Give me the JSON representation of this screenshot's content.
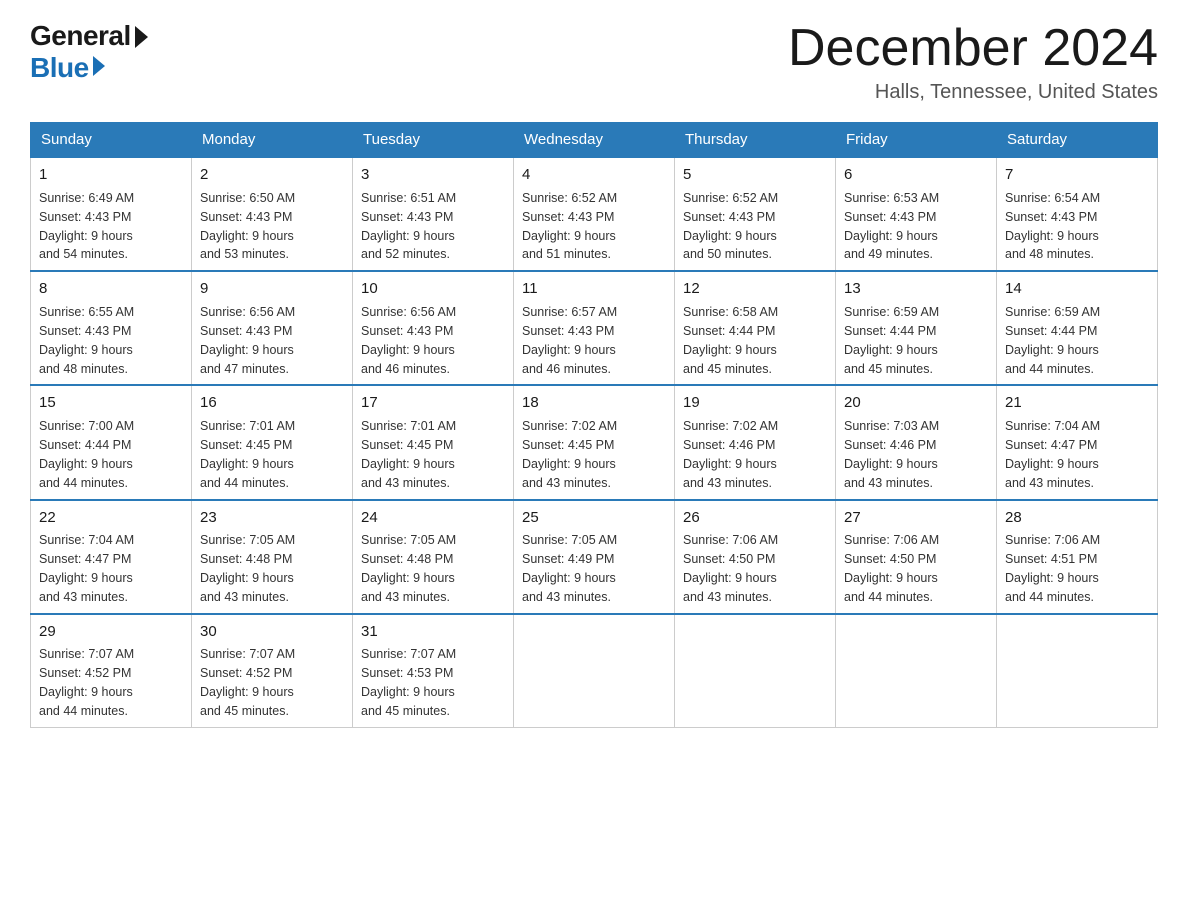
{
  "logo": {
    "general": "General",
    "blue": "Blue"
  },
  "title": "December 2024",
  "location": "Halls, Tennessee, United States",
  "days_of_week": [
    "Sunday",
    "Monday",
    "Tuesday",
    "Wednesday",
    "Thursday",
    "Friday",
    "Saturday"
  ],
  "weeks": [
    [
      {
        "day": "1",
        "sunrise": "6:49 AM",
        "sunset": "4:43 PM",
        "daylight": "9 hours and 54 minutes."
      },
      {
        "day": "2",
        "sunrise": "6:50 AM",
        "sunset": "4:43 PM",
        "daylight": "9 hours and 53 minutes."
      },
      {
        "day": "3",
        "sunrise": "6:51 AM",
        "sunset": "4:43 PM",
        "daylight": "9 hours and 52 minutes."
      },
      {
        "day": "4",
        "sunrise": "6:52 AM",
        "sunset": "4:43 PM",
        "daylight": "9 hours and 51 minutes."
      },
      {
        "day": "5",
        "sunrise": "6:52 AM",
        "sunset": "4:43 PM",
        "daylight": "9 hours and 50 minutes."
      },
      {
        "day": "6",
        "sunrise": "6:53 AM",
        "sunset": "4:43 PM",
        "daylight": "9 hours and 49 minutes."
      },
      {
        "day": "7",
        "sunrise": "6:54 AM",
        "sunset": "4:43 PM",
        "daylight": "9 hours and 48 minutes."
      }
    ],
    [
      {
        "day": "8",
        "sunrise": "6:55 AM",
        "sunset": "4:43 PM",
        "daylight": "9 hours and 48 minutes."
      },
      {
        "day": "9",
        "sunrise": "6:56 AM",
        "sunset": "4:43 PM",
        "daylight": "9 hours and 47 minutes."
      },
      {
        "day": "10",
        "sunrise": "6:56 AM",
        "sunset": "4:43 PM",
        "daylight": "9 hours and 46 minutes."
      },
      {
        "day": "11",
        "sunrise": "6:57 AM",
        "sunset": "4:43 PM",
        "daylight": "9 hours and 46 minutes."
      },
      {
        "day": "12",
        "sunrise": "6:58 AM",
        "sunset": "4:44 PM",
        "daylight": "9 hours and 45 minutes."
      },
      {
        "day": "13",
        "sunrise": "6:59 AM",
        "sunset": "4:44 PM",
        "daylight": "9 hours and 45 minutes."
      },
      {
        "day": "14",
        "sunrise": "6:59 AM",
        "sunset": "4:44 PM",
        "daylight": "9 hours and 44 minutes."
      }
    ],
    [
      {
        "day": "15",
        "sunrise": "7:00 AM",
        "sunset": "4:44 PM",
        "daylight": "9 hours and 44 minutes."
      },
      {
        "day": "16",
        "sunrise": "7:01 AM",
        "sunset": "4:45 PM",
        "daylight": "9 hours and 44 minutes."
      },
      {
        "day": "17",
        "sunrise": "7:01 AM",
        "sunset": "4:45 PM",
        "daylight": "9 hours and 43 minutes."
      },
      {
        "day": "18",
        "sunrise": "7:02 AM",
        "sunset": "4:45 PM",
        "daylight": "9 hours and 43 minutes."
      },
      {
        "day": "19",
        "sunrise": "7:02 AM",
        "sunset": "4:46 PM",
        "daylight": "9 hours and 43 minutes."
      },
      {
        "day": "20",
        "sunrise": "7:03 AM",
        "sunset": "4:46 PM",
        "daylight": "9 hours and 43 minutes."
      },
      {
        "day": "21",
        "sunrise": "7:04 AM",
        "sunset": "4:47 PM",
        "daylight": "9 hours and 43 minutes."
      }
    ],
    [
      {
        "day": "22",
        "sunrise": "7:04 AM",
        "sunset": "4:47 PM",
        "daylight": "9 hours and 43 minutes."
      },
      {
        "day": "23",
        "sunrise": "7:05 AM",
        "sunset": "4:48 PM",
        "daylight": "9 hours and 43 minutes."
      },
      {
        "day": "24",
        "sunrise": "7:05 AM",
        "sunset": "4:48 PM",
        "daylight": "9 hours and 43 minutes."
      },
      {
        "day": "25",
        "sunrise": "7:05 AM",
        "sunset": "4:49 PM",
        "daylight": "9 hours and 43 minutes."
      },
      {
        "day": "26",
        "sunrise": "7:06 AM",
        "sunset": "4:50 PM",
        "daylight": "9 hours and 43 minutes."
      },
      {
        "day": "27",
        "sunrise": "7:06 AM",
        "sunset": "4:50 PM",
        "daylight": "9 hours and 44 minutes."
      },
      {
        "day": "28",
        "sunrise": "7:06 AM",
        "sunset": "4:51 PM",
        "daylight": "9 hours and 44 minutes."
      }
    ],
    [
      {
        "day": "29",
        "sunrise": "7:07 AM",
        "sunset": "4:52 PM",
        "daylight": "9 hours and 44 minutes."
      },
      {
        "day": "30",
        "sunrise": "7:07 AM",
        "sunset": "4:52 PM",
        "daylight": "9 hours and 45 minutes."
      },
      {
        "day": "31",
        "sunrise": "7:07 AM",
        "sunset": "4:53 PM",
        "daylight": "9 hours and 45 minutes."
      },
      null,
      null,
      null,
      null
    ]
  ],
  "labels": {
    "sunrise": "Sunrise:",
    "sunset": "Sunset:",
    "daylight": "Daylight:"
  }
}
